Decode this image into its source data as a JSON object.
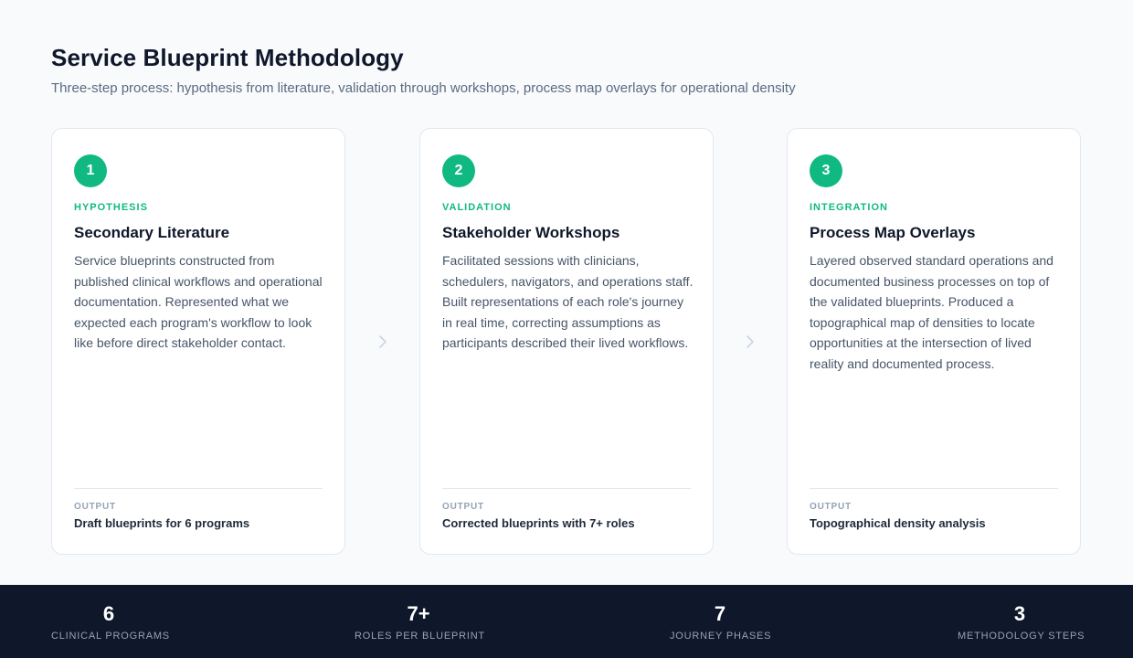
{
  "header": {
    "title": "Service Blueprint Methodology",
    "subtitle": "Three-step process: hypothesis from literature, validation through workshops, process map overlays for operational density"
  },
  "steps": [
    {
      "number": "1",
      "phase": "HYPOTHESIS",
      "title": "Secondary Literature",
      "body": "Service blueprints constructed from published clinical workflows and operational documentation. Represented what we expected each program's workflow to look like before direct stakeholder contact.",
      "output_label": "OUTPUT",
      "output_value": "Draft blueprints for 6 programs"
    },
    {
      "number": "2",
      "phase": "VALIDATION",
      "title": "Stakeholder Workshops",
      "body": "Facilitated sessions with clinicians, schedulers, navigators, and operations staff. Built representations of each role's journey in real time, correcting assumptions as participants described their lived workflows.",
      "output_label": "OUTPUT",
      "output_value": "Corrected blueprints with 7+ roles"
    },
    {
      "number": "3",
      "phase": "INTEGRATION",
      "title": "Process Map Overlays",
      "body": "Layered observed standard operations and documented business processes on top of the validated blueprints. Produced a topographical map of densities to locate opportunities at the intersection of lived reality and documented process.",
      "output_label": "OUTPUT",
      "output_value": "Topographical density analysis"
    }
  ],
  "stats": [
    {
      "value": "6",
      "label": "CLINICAL PROGRAMS"
    },
    {
      "value": "7+",
      "label": "ROLES PER BLUEPRINT"
    },
    {
      "value": "7",
      "label": "JOURNEY PHASES"
    },
    {
      "value": "3",
      "label": "METHODOLOGY STEPS"
    }
  ],
  "icons": {
    "arrow": "chevron-right-icon"
  },
  "colors": {
    "accent": "#10b981",
    "background": "#f8fafc",
    "footer": "#0f172a",
    "arrow": "#cbd5e1"
  }
}
